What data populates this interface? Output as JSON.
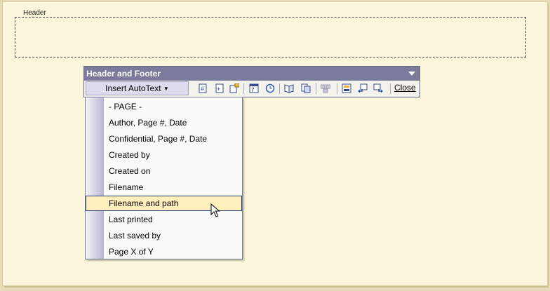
{
  "header": {
    "label": "Header"
  },
  "toolbar": {
    "title": "Header and Footer",
    "autotext_label": "Insert AutoText",
    "autotext_underline": "s",
    "close_label": "Close",
    "icons": [
      "insert-page-number-icon",
      "insert-number-of-pages-icon",
      "format-page-number-icon",
      "insert-date-icon",
      "insert-time-icon",
      "page-setup-icon",
      "show-hide-document-text-icon",
      "same-as-previous-icon",
      "switch-header-footer-icon",
      "show-previous-icon",
      "show-next-icon"
    ]
  },
  "menu": {
    "items": [
      "- PAGE -",
      "Author, Page #, Date",
      "Confidential, Page #, Date",
      "Created by",
      "Created on",
      "Filename",
      "Filename and path",
      "Last printed",
      "Last saved by",
      "Page X of Y"
    ],
    "hovered_index": 6
  },
  "colors": {
    "page_bg": "#fbf6dc",
    "toolbar_title_bg": "#7a7a9a",
    "menu_hover_bg": "#ffefbd",
    "menu_hover_border": "#2c3b7a"
  }
}
